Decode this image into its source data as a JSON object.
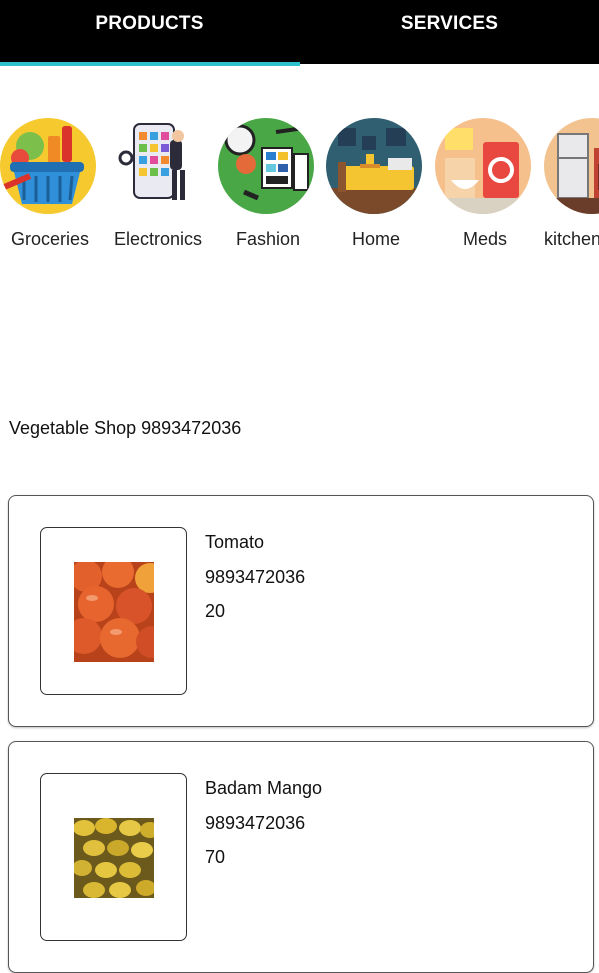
{
  "tabs": [
    {
      "label": "PRODUCTS",
      "active": true
    },
    {
      "label": "SERVICES",
      "active": false
    }
  ],
  "accent_color": "#2cc0cc",
  "categories": [
    {
      "label": "Groceries",
      "icon": "grocery-basket-icon"
    },
    {
      "label": "Electronics",
      "icon": "smartphone-icon"
    },
    {
      "label": "Fashion",
      "icon": "cosmetics-icon"
    },
    {
      "label": "Home",
      "icon": "bedroom-icon"
    },
    {
      "label": "Meds",
      "icon": "pharmacy-icon"
    },
    {
      "label": "kitchen",
      "icon": "kitchen-icon"
    }
  ],
  "shop": {
    "title": "Vegetable Shop 9893472036"
  },
  "products": [
    {
      "name": "Tomato",
      "phone": "9893472036",
      "price": "20",
      "image": "tomato-photo"
    },
    {
      "name": "Badam Mango",
      "phone": "9893472036",
      "price": "70",
      "image": "mango-photo"
    }
  ]
}
